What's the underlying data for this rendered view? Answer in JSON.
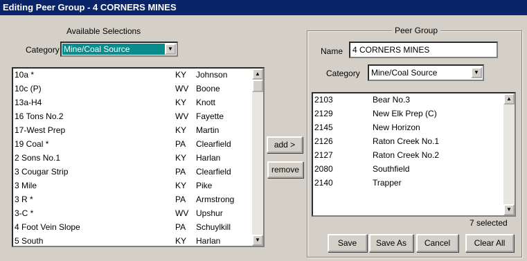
{
  "window": {
    "title": "Editing Peer Group - 4 CORNERS MINES"
  },
  "available": {
    "title": "Available Selections",
    "category_label": "Category",
    "category_value": "Mine/Coal Source",
    "rows": [
      {
        "name": "10a *",
        "state": "KY",
        "county": "Johnson"
      },
      {
        "name": "10c (P)",
        "state": "WV",
        "county": "Boone"
      },
      {
        "name": "13a-H4",
        "state": "KY",
        "county": "Knott"
      },
      {
        "name": "16 Tons No.2",
        "state": "WV",
        "county": "Fayette"
      },
      {
        "name": "17-West Prep",
        "state": "KY",
        "county": "Martin"
      },
      {
        "name": "19 Coal *",
        "state": "PA",
        "county": "Clearfield"
      },
      {
        "name": "2 Sons No.1",
        "state": "KY",
        "county": "Harlan"
      },
      {
        "name": "3 Cougar Strip",
        "state": "PA",
        "county": "Clearfield"
      },
      {
        "name": "3 Mile",
        "state": "KY",
        "county": "Pike"
      },
      {
        "name": "3 R *",
        "state": "PA",
        "county": "Armstrong"
      },
      {
        "name": "3-C *",
        "state": "WV",
        "county": "Upshur"
      },
      {
        "name": "4 Foot Vein Slope",
        "state": "PA",
        "county": "Schuylkill"
      },
      {
        "name": "5 South",
        "state": "KY",
        "county": "Harlan"
      }
    ]
  },
  "actions": {
    "add_label": "add >",
    "remove_label": "remove"
  },
  "peer_group": {
    "title": "Peer Group",
    "name_label": "Name",
    "name_value": "4 CORNERS MINES",
    "category_label": "Category",
    "category_value": "Mine/Coal Source",
    "rows": [
      {
        "id": "2103",
        "name": "Bear No.3"
      },
      {
        "id": "2129",
        "name": "New Elk Prep (C)"
      },
      {
        "id": "2145",
        "name": "New Horizon"
      },
      {
        "id": "2126",
        "name": "Raton Creek No.1"
      },
      {
        "id": "2127",
        "name": "Raton Creek No.2"
      },
      {
        "id": "2080",
        "name": "Southfield"
      },
      {
        "id": "2140",
        "name": "Trapper"
      }
    ],
    "selected_count": "7 selected"
  },
  "footer": {
    "save": "Save",
    "save_as": "Save As",
    "cancel": "Cancel",
    "clear_all": "Clear All"
  }
}
